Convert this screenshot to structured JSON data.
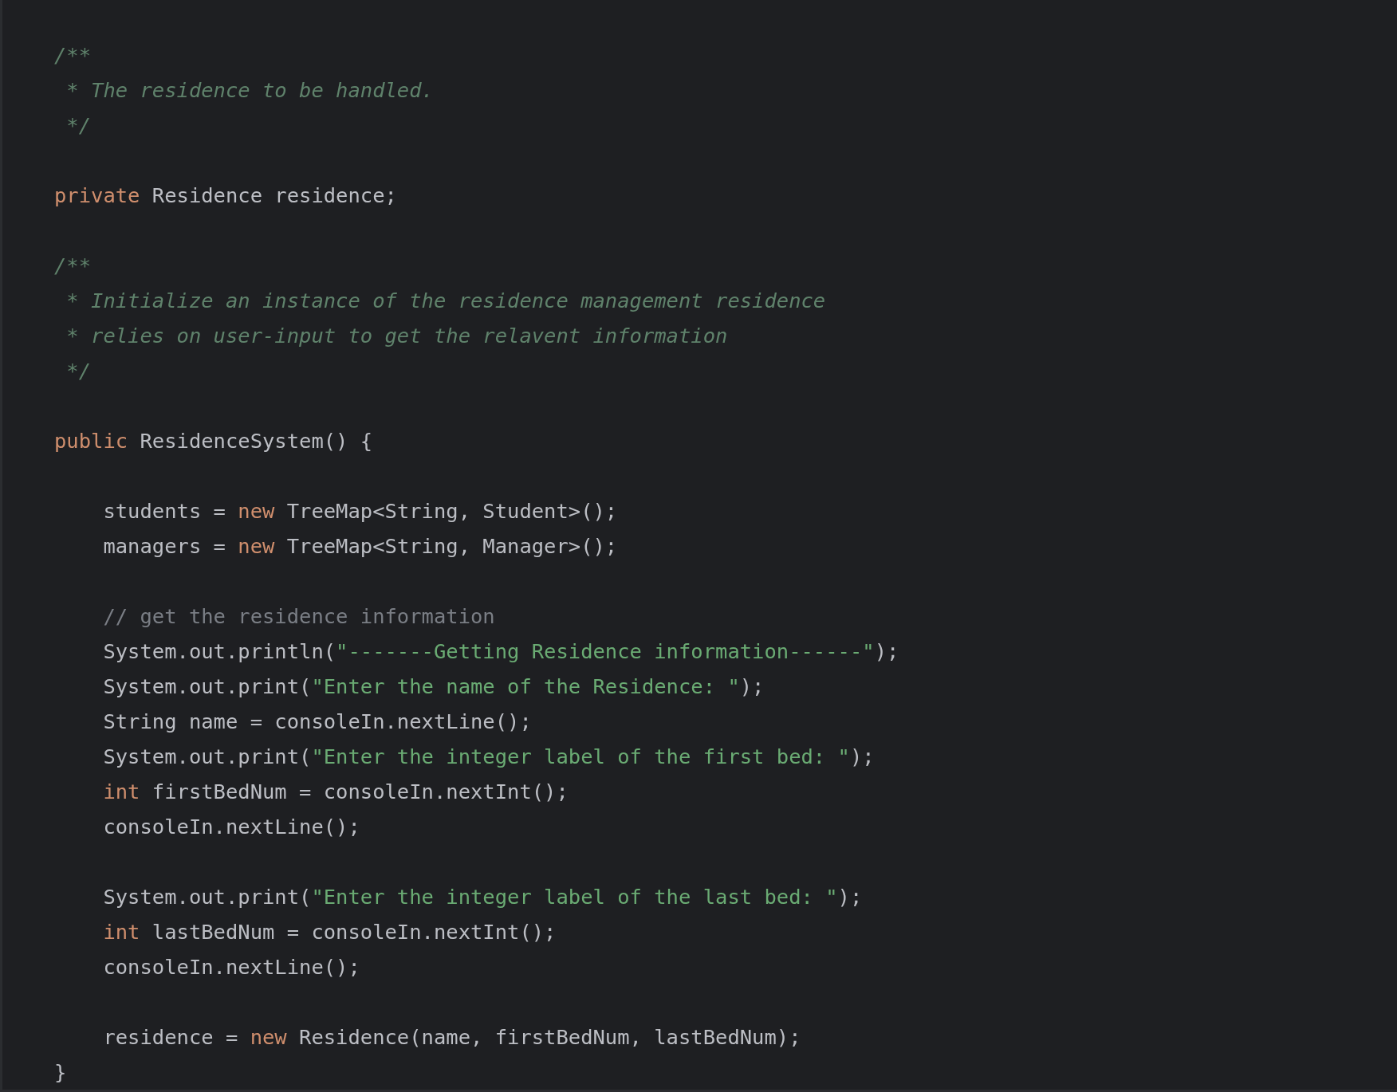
{
  "editor": {
    "blocks": [
      {
        "lines": [
          [
            {
              "kind": "doc",
              "text": "/**"
            }
          ],
          [
            {
              "kind": "doc",
              "text": " * The residence to be handled."
            }
          ],
          [
            {
              "kind": "doc",
              "text": " */"
            }
          ]
        ]
      },
      {
        "lines": [
          [
            {
              "kind": "keyword",
              "text": "private"
            },
            {
              "kind": "plain",
              "text": " Residence residence;"
            }
          ]
        ]
      },
      {
        "lines": [
          [
            {
              "kind": "doc",
              "text": "/**"
            }
          ],
          [
            {
              "kind": "doc",
              "text": " * Initialize an instance of the residence management residence"
            }
          ],
          [
            {
              "kind": "doc",
              "text": " * relies on user-input to get the relavent information"
            }
          ],
          [
            {
              "kind": "doc",
              "text": " */"
            }
          ]
        ]
      },
      {
        "lines": [
          [
            {
              "kind": "keyword",
              "text": "public"
            },
            {
              "kind": "plain",
              "text": " ResidenceSystem() {"
            }
          ]
        ]
      },
      {
        "lines": [
          [
            {
              "kind": "plain",
              "text": "    students = "
            },
            {
              "kind": "keyword",
              "text": "new"
            },
            {
              "kind": "plain",
              "text": " TreeMap<String, Student>();"
            }
          ],
          [
            {
              "kind": "plain",
              "text": "    managers = "
            },
            {
              "kind": "keyword",
              "text": "new"
            },
            {
              "kind": "plain",
              "text": " TreeMap<String, Manager>();"
            }
          ]
        ]
      },
      {
        "lines": [
          [
            {
              "kind": "comment",
              "text": "    // get the residence information"
            }
          ],
          [
            {
              "kind": "plain",
              "text": "    System.out.println("
            },
            {
              "kind": "string",
              "text": "\"-------Getting Residence information------\""
            },
            {
              "kind": "plain",
              "text": ");"
            }
          ],
          [
            {
              "kind": "plain",
              "text": "    System.out.print("
            },
            {
              "kind": "string",
              "text": "\"Enter the name of the Residence: \""
            },
            {
              "kind": "plain",
              "text": ");"
            }
          ],
          [
            {
              "kind": "plain",
              "text": "    String name = consoleIn.nextLine();"
            }
          ],
          [
            {
              "kind": "plain",
              "text": "    System.out.print("
            },
            {
              "kind": "string",
              "text": "\"Enter the integer label of the first bed: \""
            },
            {
              "kind": "plain",
              "text": ");"
            }
          ],
          [
            {
              "kind": "keyword",
              "text": "    int"
            },
            {
              "kind": "plain",
              "text": " firstBedNum = consoleIn.nextInt();"
            }
          ],
          [
            {
              "kind": "plain",
              "text": "    consoleIn.nextLine();"
            }
          ]
        ]
      },
      {
        "lines": [
          [
            {
              "kind": "plain",
              "text": "    System.out.print("
            },
            {
              "kind": "string",
              "text": "\"Enter the integer label of the last bed: \""
            },
            {
              "kind": "plain",
              "text": ");"
            }
          ],
          [
            {
              "kind": "keyword",
              "text": "    int"
            },
            {
              "kind": "plain",
              "text": " lastBedNum = consoleIn.nextInt();"
            }
          ],
          [
            {
              "kind": "plain",
              "text": "    consoleIn.nextLine();"
            }
          ]
        ]
      },
      {
        "lines": [
          [
            {
              "kind": "plain",
              "text": "    residence = "
            },
            {
              "kind": "keyword",
              "text": "new"
            },
            {
              "kind": "plain",
              "text": " Residence(name, firstBedNum, lastBedNum);"
            }
          ],
          [
            {
              "kind": "plain",
              "text": "}"
            }
          ]
        ]
      }
    ]
  }
}
